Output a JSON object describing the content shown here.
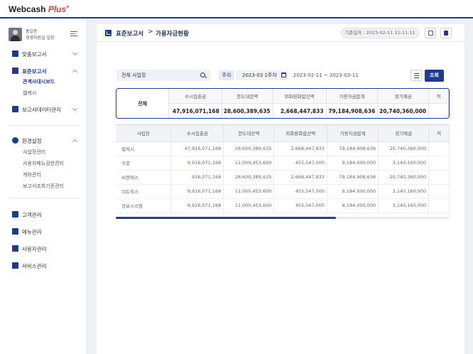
{
  "app": {
    "logo_text": "Webcash",
    "logo_accent": "Plus",
    "logo_sup": "+",
    "brand_color": "#1f3a93",
    "accent_color": "#e03c31"
  },
  "profile": {
    "name": "홍길동",
    "role": "경영지원실 실장"
  },
  "sidebar": {
    "items": [
      {
        "label": "맞춤보고서",
        "icon": "pencil-icon",
        "expanded": false
      },
      {
        "label": "표준보고서",
        "icon": "bar-chart-icon",
        "expanded": true,
        "active": true
      },
      {
        "label": "보고서데이터관리",
        "icon": "line-chart-icon",
        "expanded": false
      },
      {
        "label": "환경설정",
        "icon": "gear-icon",
        "expanded": true
      },
      {
        "label": "고객관리",
        "icon": "customer-icon"
      },
      {
        "label": "메뉴관리",
        "icon": "menu-icon"
      },
      {
        "label": "사용자관리",
        "icon": "user-icon"
      },
      {
        "label": "서비스관리",
        "icon": "service-icon"
      }
    ],
    "report_sub": [
      "관계사대시보드",
      "웹케시"
    ],
    "settings_sub": [
      "사업장관리",
      "사용자메뉴권한관리",
      "계좌관리",
      "보고서조회기준관리"
    ]
  },
  "header": {
    "breadcrumb_1": "표준보고서",
    "breadcrumb_sep": ">",
    "breadcrumb_2": "가용자금현황",
    "base_date": "기준일자 : 2023-02-11 11:11:11"
  },
  "filters": {
    "business_value": "전체 사업장",
    "period_label": "주차",
    "week_value": "2023-03 1주차",
    "date_range": "2023-02-11 ~ 2023-03-11",
    "query_label": "조회"
  },
  "summary": {
    "label": "전체",
    "columns": [
      "수시입출금",
      "한도대잔액",
      "외화환화합산액",
      "가용자금합계",
      "정기예금",
      "적"
    ],
    "values": [
      "47,916,071,168",
      "28,600,389,635",
      "2,668,447,833",
      "79,184,908,636",
      "20,740,360,000",
      ""
    ]
  },
  "detail": {
    "columns": [
      "사업장",
      "수시입출금",
      "한도대잔액",
      "외화환화합산액",
      "가용자금합계",
      "정기예금",
      "적"
    ],
    "rows": [
      [
        "웹케시",
        "47,916,071,168",
        "28,600,389,635",
        "2,668,447,833",
        "79,184,908,636",
        "20,740,360,000",
        ""
      ],
      [
        "쿠콘",
        "9,916,071,168",
        "11,000,453,600",
        "455,547,000",
        "9,184,000,000",
        "3,140,160,000",
        ""
      ],
      [
        "씨엔에스",
        "916,071,168",
        "28,600,389,635",
        "2,668,447,833",
        "79,184,908,636",
        "20,740,360,000",
        ""
      ],
      [
        "네트웍스",
        "9,916,071,168",
        "11,000,453,600",
        "455,547,000",
        "9,184,000,000",
        "3,140,160,000",
        ""
      ],
      [
        "정보시스템",
        "9,916,071,168",
        "11,000,453,600",
        "455,547,000",
        "9,184,000,000",
        "3,140,160,000",
        ""
      ]
    ]
  },
  "scroll": {
    "position": 0.66
  }
}
